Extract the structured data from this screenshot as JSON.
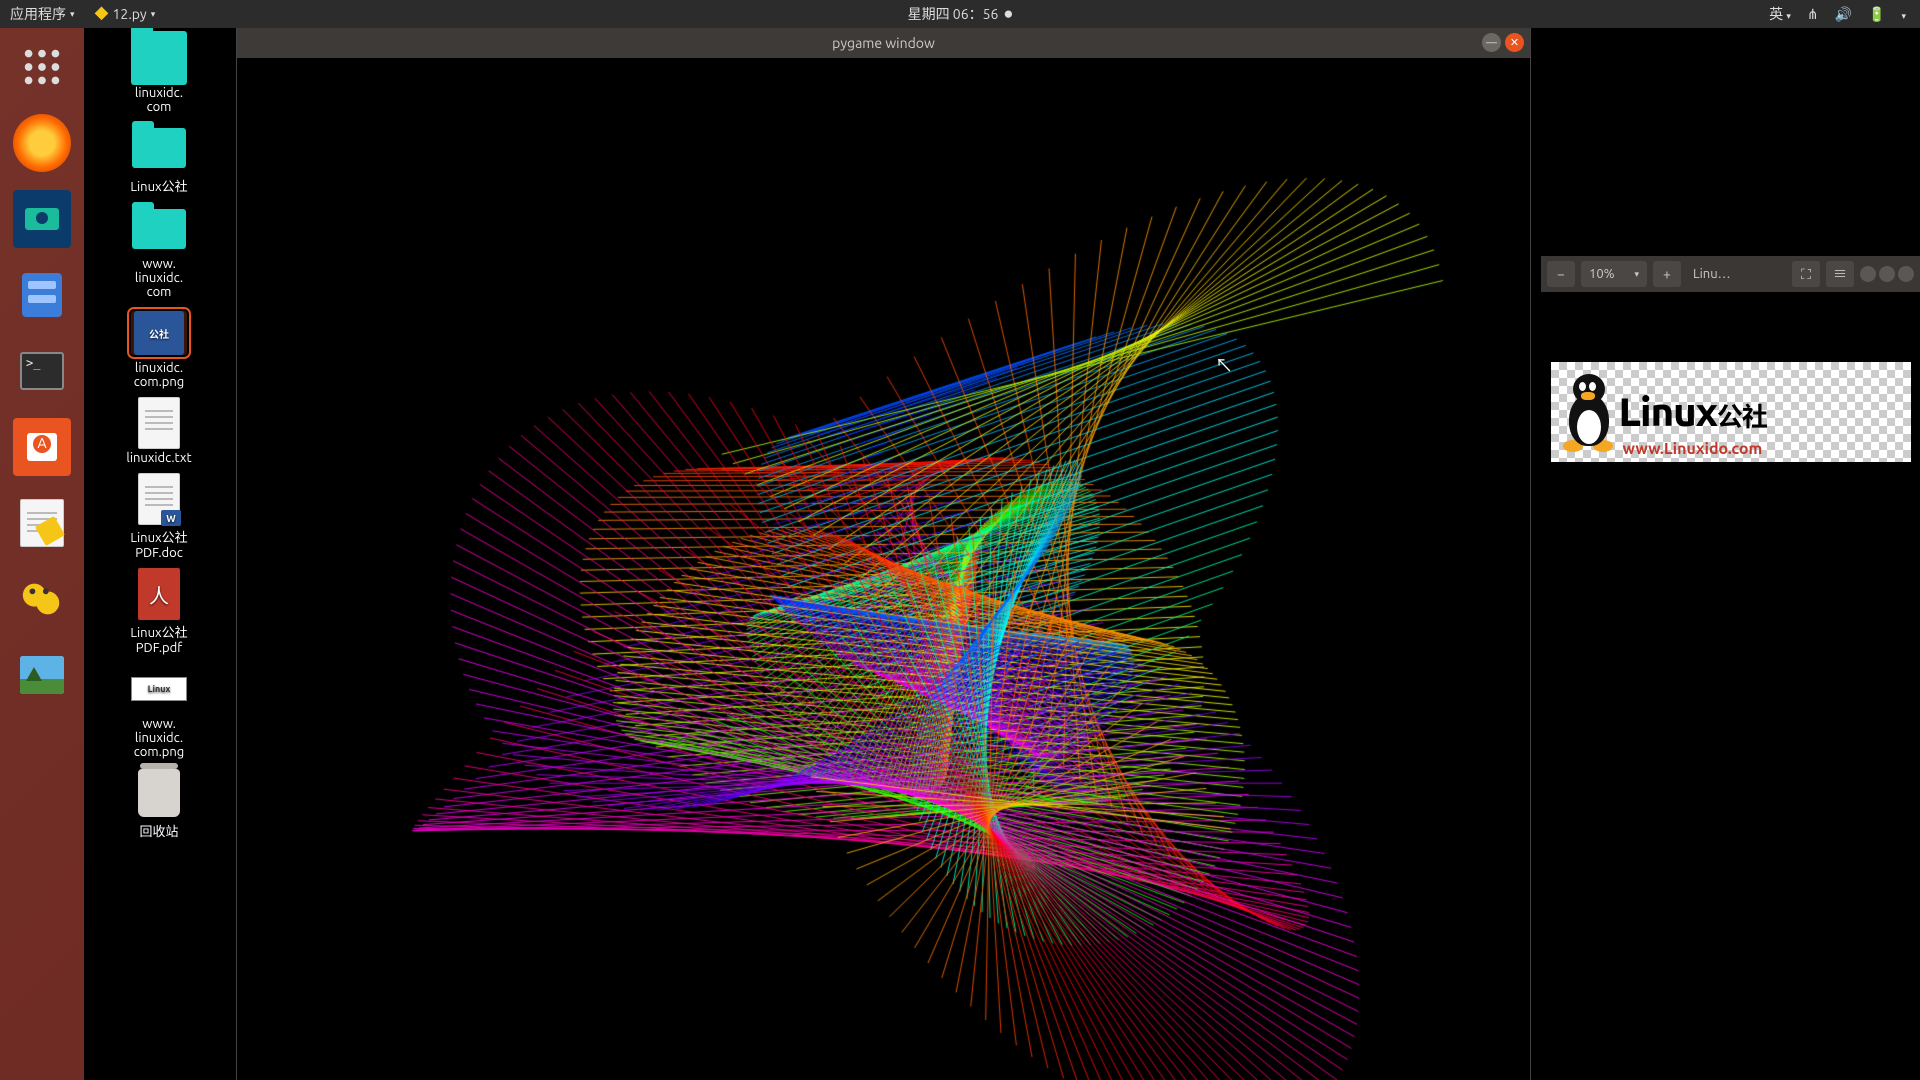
{
  "topbar": {
    "app_menu": "应用程序",
    "filename": "12.py",
    "datetime": "星期四 06：56",
    "ime": "英"
  },
  "desktop": {
    "items": [
      {
        "label": "linuxidc.\ncom",
        "type": "folder",
        "big": true
      },
      {
        "label": "Linux公社",
        "type": "folder"
      },
      {
        "label": "www.\nlinuxidc.\ncom",
        "type": "folder"
      },
      {
        "label": "linuxidc.\ncom.png",
        "type": "png",
        "sel": true
      },
      {
        "label": "linuxidc.txt",
        "type": "txt"
      },
      {
        "label": "Linux公社\nPDF.doc",
        "type": "doc"
      },
      {
        "label": "Linux公社\nPDF.pdf",
        "type": "pdf"
      },
      {
        "label": "www.\nlinuxidc.\ncom.png",
        "type": "pngthumb"
      },
      {
        "label": "回收站",
        "type": "trash"
      }
    ]
  },
  "pygame": {
    "title": "pygame window"
  },
  "viewer": {
    "zoom": "10%",
    "title": "Linu…",
    "logo_text": "Linux",
    "logo_cn": "公社",
    "logo_url": "www.Linuxido.com"
  }
}
